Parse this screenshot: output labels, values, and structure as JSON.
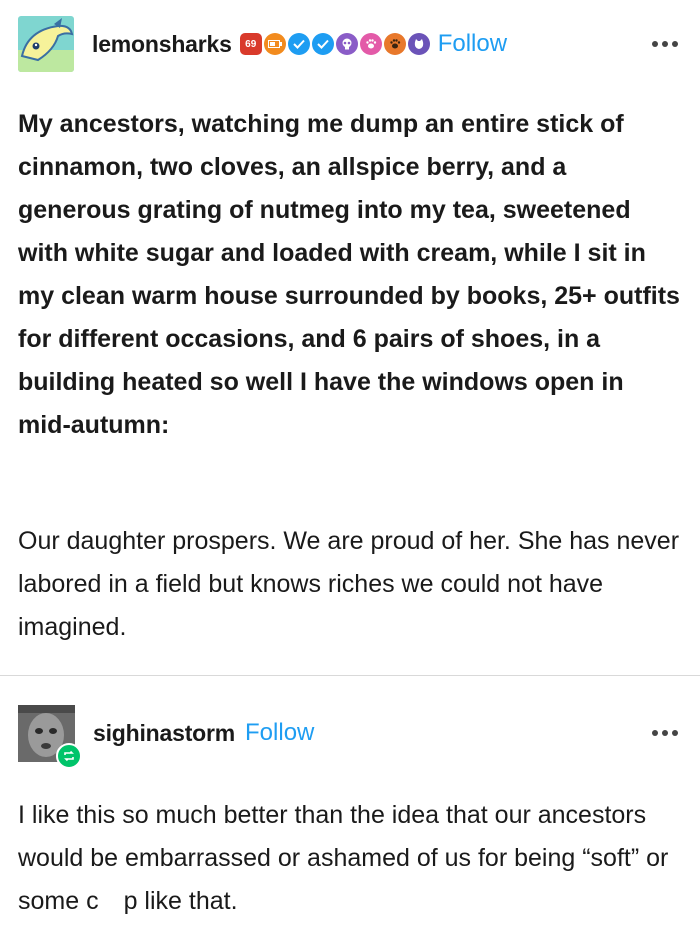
{
  "post": {
    "username": "lemonsharks",
    "follow_label": "Follow",
    "badges": [
      {
        "name": "red-shield-badge",
        "color": "#d93a2b",
        "text": "69"
      },
      {
        "name": "orange-battery-badge",
        "color": "#f28b1e",
        "text": ""
      },
      {
        "name": "verified-badge-1",
        "color": "#1e9df2",
        "text": ""
      },
      {
        "name": "verified-badge-2",
        "color": "#1e9df2",
        "text": ""
      },
      {
        "name": "skull-badge",
        "color": "#8a5cc7",
        "text": ""
      },
      {
        "name": "paw-pink-badge",
        "color": "#e35aa8",
        "text": ""
      },
      {
        "name": "paw-orange-badge",
        "color": "#e8782b",
        "text": ""
      },
      {
        "name": "cat-badge",
        "color": "#6b53b8",
        "text": ""
      }
    ],
    "bold_text": "My ancestors, watching me dump an entire stick of cinnamon, two cloves, an allspice berry, and a generous grating of nutmeg into my tea, sweetened with white sugar and loaded with cream, while I sit in my clean warm house surrounded by books, 25+ outfits for different occasions, and 6 pairs of shoes, in a building heated so well I have the windows open in mid-autumn:",
    "plain_text": "Our daughter prospers. We are proud of her. She has never labored in a field but knows riches we could not have imagined."
  },
  "reply": {
    "username": "sighinastorm",
    "follow_label": "Follow",
    "text": "I like this so much better than the idea that our ancestors would be embarrassed or ashamed of us for being “soft” or some c p like that."
  },
  "colors": {
    "follow": "#1e9df2",
    "reblog": "#00c46a"
  }
}
